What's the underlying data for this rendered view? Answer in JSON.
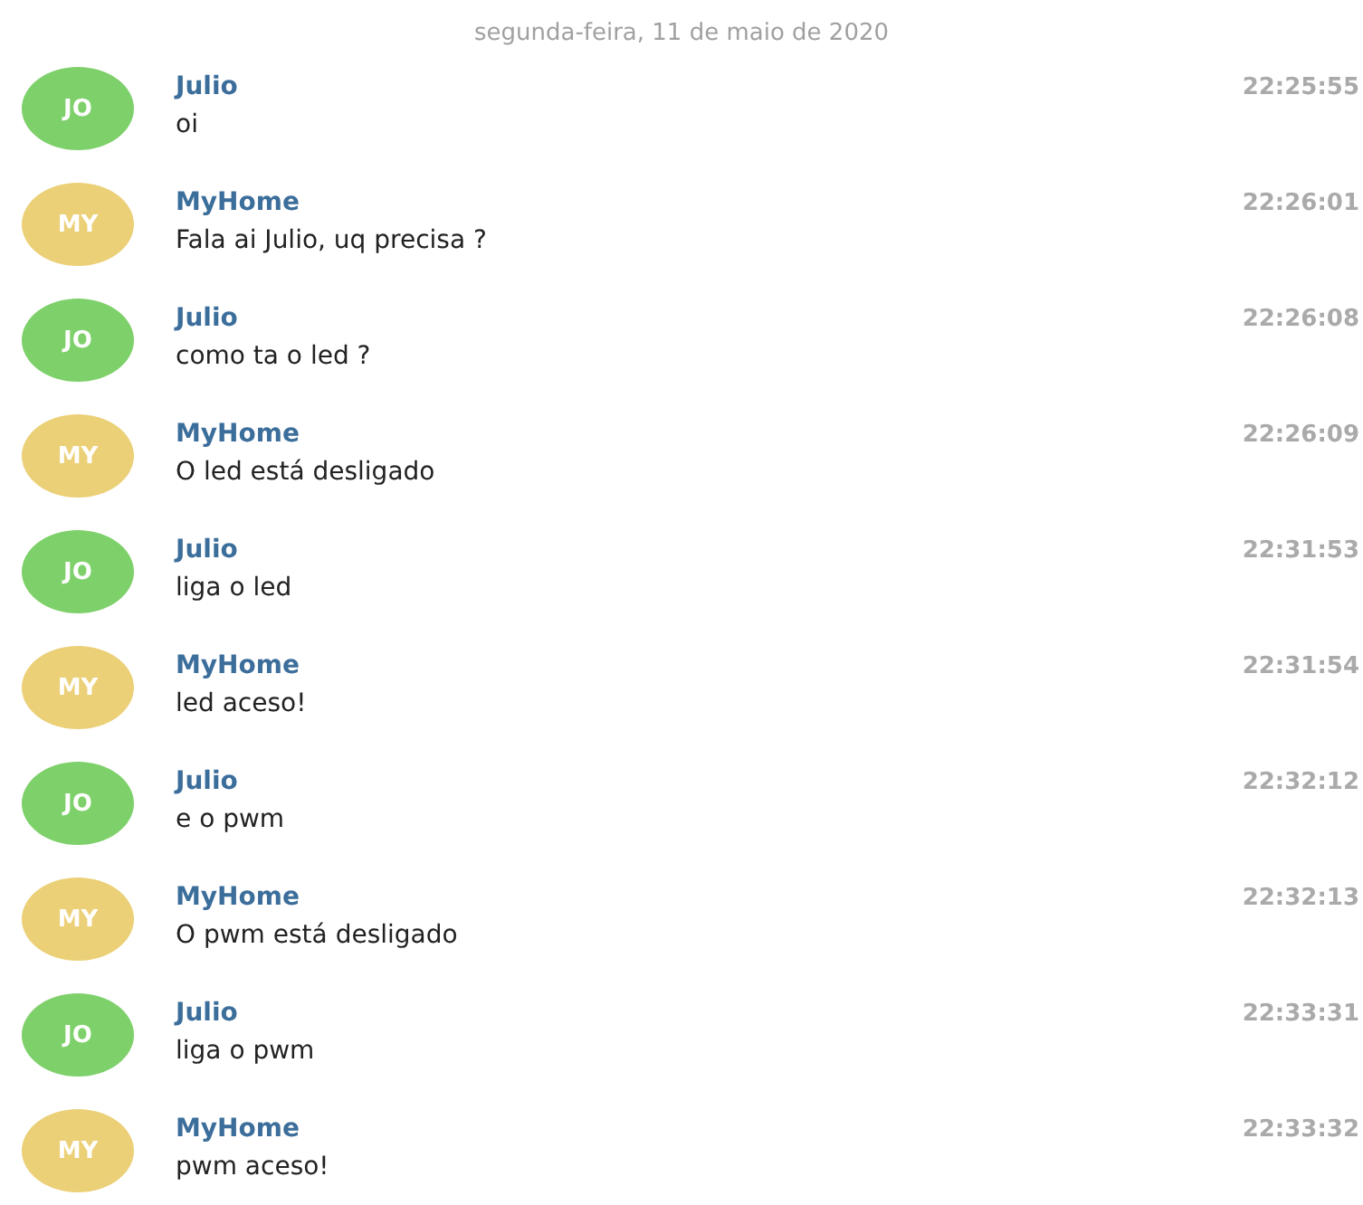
{
  "date_separator": "segunda-feira, 11 de maio de 2020",
  "messages": [
    {
      "initials": "JO",
      "color": "#7ed06a",
      "sender": "Julio",
      "text": "oi",
      "time": "22:25:55"
    },
    {
      "initials": "MY",
      "color": "#ebd077",
      "sender": "MyHome",
      "text": "Fala ai Julio, uq precisa ?",
      "time": "22:26:01"
    },
    {
      "initials": "JO",
      "color": "#7ed06a",
      "sender": "Julio",
      "text": "como ta o led ?",
      "time": "22:26:08"
    },
    {
      "initials": "MY",
      "color": "#ebd077",
      "sender": "MyHome",
      "text": "O led está desligado",
      "time": "22:26:09"
    },
    {
      "initials": "JO",
      "color": "#7ed06a",
      "sender": "Julio",
      "text": "liga o led",
      "time": "22:31:53"
    },
    {
      "initials": "MY",
      "color": "#ebd077",
      "sender": "MyHome",
      "text": "led aceso!",
      "time": "22:31:54"
    },
    {
      "initials": "JO",
      "color": "#7ed06a",
      "sender": "Julio",
      "text": "e o pwm",
      "time": "22:32:12"
    },
    {
      "initials": "MY",
      "color": "#ebd077",
      "sender": "MyHome",
      "text": "O pwm está desligado",
      "time": "22:32:13"
    },
    {
      "initials": "JO",
      "color": "#7ed06a",
      "sender": "Julio",
      "text": "liga o pwm",
      "time": "22:33:31"
    },
    {
      "initials": "MY",
      "color": "#ebd077",
      "sender": "MyHome",
      "text": "pwm aceso!",
      "time": "22:33:32"
    }
  ]
}
